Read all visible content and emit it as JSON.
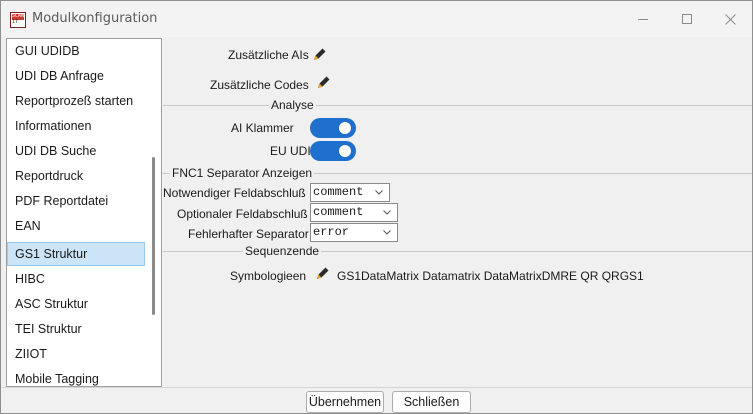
{
  "window": {
    "title": "Modulkonfiguration",
    "icon_name": "app-logo-icon",
    "icon_text_top": "SCAN",
    "icon_text_bottom": "IT"
  },
  "sidebar": {
    "items": [
      {
        "label": "GUI UDIDB",
        "selected": false
      },
      {
        "label": "UDI DB Anfrage",
        "selected": false
      },
      {
        "label": "Reportprozeß starten",
        "selected": false
      },
      {
        "label": "Informationen",
        "selected": false
      },
      {
        "label": "UDI DB Suche",
        "selected": false
      },
      {
        "label": "Reportdruck",
        "selected": false
      },
      {
        "label": "PDF Reportdatei",
        "selected": false
      },
      {
        "label": "EAN",
        "selected": false
      },
      {
        "label": "GS1 Struktur",
        "selected": true
      },
      {
        "label": "HIBC",
        "selected": false
      },
      {
        "label": "ASC Struktur",
        "selected": false
      },
      {
        "label": "TEI Struktur",
        "selected": false
      },
      {
        "label": "ZIIOT",
        "selected": false
      },
      {
        "label": "Mobile Tagging",
        "selected": false
      }
    ]
  },
  "main": {
    "extra_ais_label": "Zusätzliche AIs",
    "extra_codes_label": "Zusätzliche Codes",
    "analyse_title": "Analyse",
    "ai_brackets_label": "AI Klammer",
    "ai_brackets_on": true,
    "eu_udi_label": "EU UDI",
    "eu_udi_on": true,
    "fnc1_title": "FNC1 Separator Anzeigen",
    "required_terminator_label": "Notwendiger Feldabschluß",
    "required_terminator_value": "comment",
    "optional_terminator_label": "Optionaler Feldabschluß",
    "optional_terminator_value": "comment",
    "faulty_separator_label": "Fehlerhafter Separator",
    "faulty_separator_value": "error",
    "sequence_end_title": "Sequenzende",
    "symbologies_label": "Symbologieen",
    "symbologies_value": "GS1DataMatrix Datamatrix DataMatrixDMRE QR QRGS1"
  },
  "footer": {
    "apply_label": "Übernehmen",
    "close_label": "Schließen"
  },
  "colors": {
    "toggle_on": "#1f6fcf",
    "selection": "#cce4f7",
    "pencil_body": "#2b2b2b",
    "pencil_tip": "#f0a020"
  }
}
